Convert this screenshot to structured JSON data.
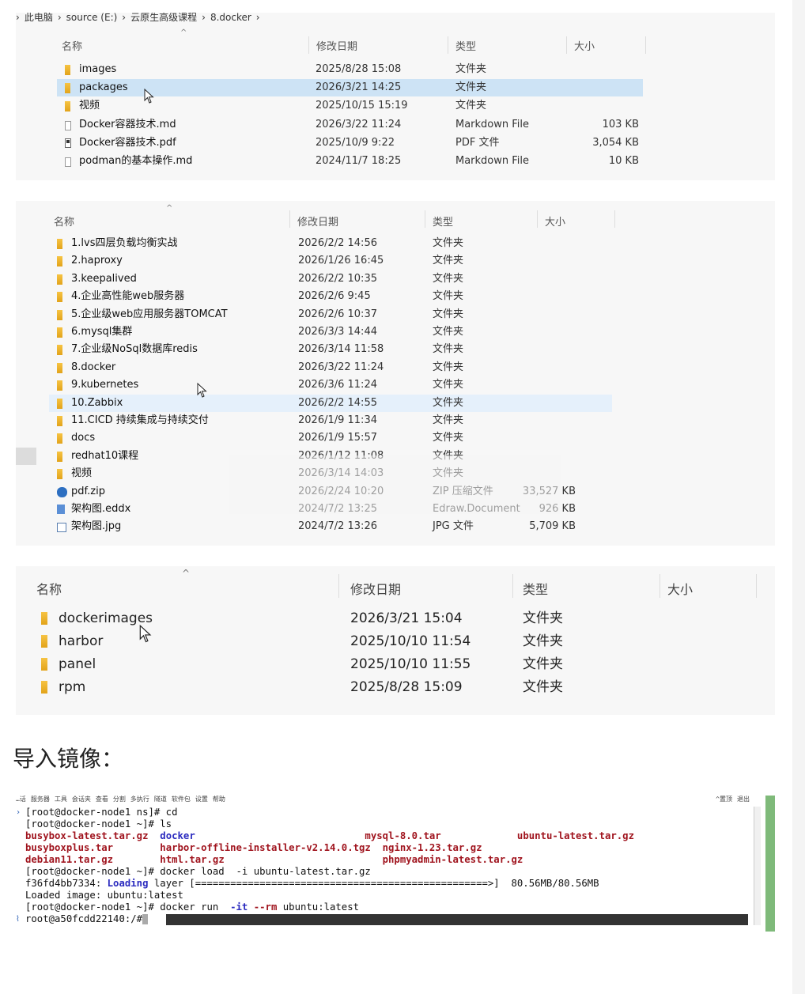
{
  "panel1": {
    "breadcrumb": [
      "›",
      "此电脑",
      "›",
      "source (E:)",
      "›",
      "云原生高级课程",
      "›",
      "8.docker",
      "›"
    ],
    "columns": {
      "name": "名称",
      "modified": "修改日期",
      "type": "类型",
      "size": "大小"
    },
    "rows": [
      {
        "icon": "folder-icon",
        "name": "images",
        "date": "2025/8/28 15:08",
        "type": "文件夹",
        "size": ""
      },
      {
        "icon": "folder-icon",
        "name": "packages",
        "date": "2026/3/21 14:25",
        "type": "文件夹",
        "size": ""
      },
      {
        "icon": "folder-icon",
        "name": "视频",
        "date": "2025/10/15 15:19",
        "type": "文件夹",
        "size": ""
      },
      {
        "icon": "markdown-file-icon",
        "name": "Docker容器技术.md",
        "date": "2026/3/22 11:24",
        "type": "Markdown File",
        "size": "103 KB"
      },
      {
        "icon": "pdf-file-icon",
        "name": "Docker容器技术.pdf",
        "date": "2025/10/9 9:22",
        "type": "PDF 文件",
        "size": "3,054 KB"
      },
      {
        "icon": "markdown-file-icon",
        "name": "podman的基本操作.md",
        "date": "2024/11/7 18:25",
        "type": "Markdown File",
        "size": "10 KB"
      }
    ]
  },
  "panel2": {
    "columns": {
      "name": "名称",
      "modified": "修改日期",
      "type": "类型",
      "size": "大小"
    },
    "rows": [
      {
        "icon": "folder-icon",
        "name": "1.lvs四层负载均衡实战",
        "date": "2026/2/2 14:56",
        "type": "文件夹",
        "size": ""
      },
      {
        "icon": "folder-icon",
        "name": "2.haproxy",
        "date": "2026/1/26 16:45",
        "type": "文件夹",
        "size": ""
      },
      {
        "icon": "folder-icon",
        "name": "3.keepalived",
        "date": "2026/2/2 10:35",
        "type": "文件夹",
        "size": ""
      },
      {
        "icon": "folder-icon",
        "name": "4.企业高性能web服务器",
        "date": "2026/2/6 9:45",
        "type": "文件夹",
        "size": ""
      },
      {
        "icon": "folder-icon",
        "name": "5.企业级web应用服务器TOMCAT",
        "date": "2026/2/6 10:37",
        "type": "文件夹",
        "size": ""
      },
      {
        "icon": "folder-icon",
        "name": "6.mysql集群",
        "date": "2026/3/3 14:44",
        "type": "文件夹",
        "size": ""
      },
      {
        "icon": "folder-icon",
        "name": "7.企业级NoSql数据库redis",
        "date": "2026/3/14 11:58",
        "type": "文件夹",
        "size": ""
      },
      {
        "icon": "folder-icon",
        "name": "8.docker",
        "date": "2026/3/22 11:24",
        "type": "文件夹",
        "size": ""
      },
      {
        "icon": "folder-icon",
        "name": "9.kubernetes",
        "date": "2026/3/6 11:24",
        "type": "文件夹",
        "size": ""
      },
      {
        "icon": "folder-icon",
        "name": "10.Zabbix",
        "date": "2026/2/2 14:55",
        "type": "文件夹",
        "size": ""
      },
      {
        "icon": "folder-icon",
        "name": "11.CICD  持续集成与持续交付",
        "date": "2026/1/9 11:34",
        "type": "文件夹",
        "size": ""
      },
      {
        "icon": "folder-icon",
        "name": "docs",
        "date": "2026/1/9 15:57",
        "type": "文件夹",
        "size": ""
      },
      {
        "icon": "folder-icon",
        "name": "redhat10课程",
        "date": "2026/1/12 11:08",
        "type": "文件夹",
        "size": ""
      },
      {
        "icon": "folder-icon",
        "name": "视频",
        "date": "2026/3/14 14:03",
        "type": "文件夹",
        "size": ""
      },
      {
        "icon": "zip-file-icon",
        "name": "pdf.zip",
        "date": "2026/2/24 10:20",
        "type": "ZIP 压缩文件",
        "size": "33,527 KB"
      },
      {
        "icon": "eddx-file-icon",
        "name": "架构图.eddx",
        "date": "2024/7/2 13:25",
        "type": "Edraw.Document",
        "size": "926 KB"
      },
      {
        "icon": "image-file-icon",
        "name": "架构图.jpg",
        "date": "2024/7/2 13:26",
        "type": "JPG 文件",
        "size": "5,709 KB"
      }
    ]
  },
  "panel3": {
    "columns": {
      "name": "名称",
      "modified": "修改日期",
      "type": "类型",
      "size": "大小"
    },
    "rows": [
      {
        "icon": "folder-icon",
        "name": "dockerimages",
        "date": "2026/3/21 15:04",
        "type": "文件夹"
      },
      {
        "icon": "folder-icon",
        "name": "harbor",
        "date": "2025/10/10 11:54",
        "type": "文件夹"
      },
      {
        "icon": "folder-icon",
        "name": "panel",
        "date": "2025/10/10 11:55",
        "type": "文件夹"
      },
      {
        "icon": "folder-icon",
        "name": "rpm",
        "date": "2025/8/28 15:09",
        "type": "文件夹"
      }
    ]
  },
  "heading": "导入镜像：",
  "terminal": {
    "menu": [
      "…话",
      "服务器",
      "工具",
      "会话夹",
      "查看",
      "分割",
      "多执行",
      "隧道",
      "软件包",
      "设置",
      "帮助"
    ],
    "menu_right": [
      "^置顶",
      "退出"
    ],
    "lines": [
      [
        {
          "t": "[root@docker-node1 ns]# cd"
        }
      ],
      [
        {
          "t": "[root@docker-node1 ~]# ls"
        }
      ],
      [
        {
          "t": "busybox-latest.tar.gz",
          "c": "tr"
        },
        {
          "t": "  "
        },
        {
          "t": "docker",
          "c": "tb"
        },
        {
          "t": "                             "
        },
        {
          "t": "mysql-8.0.tar",
          "c": "tr"
        },
        {
          "t": "             "
        },
        {
          "t": "ubuntu-latest.tar.gz",
          "c": "tr"
        }
      ],
      [
        {
          "t": "busyboxplus.tar",
          "c": "tr"
        },
        {
          "t": "        "
        },
        {
          "t": "harbor-offline-installer-v2.14.0.tgz",
          "c": "tr"
        },
        {
          "t": "  "
        },
        {
          "t": "nginx-1.23.tar.gz",
          "c": "tr"
        }
      ],
      [
        {
          "t": "debian11.tar.gz",
          "c": "tr"
        },
        {
          "t": "        "
        },
        {
          "t": "html.tar.gz",
          "c": "tr"
        },
        {
          "t": "                           "
        },
        {
          "t": "phpmyadmin-latest.tar.gz",
          "c": "tr"
        }
      ],
      [
        {
          "t": "[root@docker-node1 ~]# docker load  -i ubuntu-latest.tar.gz"
        }
      ],
      [
        {
          "t": "f36fd4bb7334: "
        },
        {
          "t": "Loading",
          "c": "tb"
        },
        {
          "t": " layer [==================================================>]  80.56MB/80.56MB"
        }
      ],
      [
        {
          "t": "Loaded image: ubuntu:latest"
        }
      ],
      [
        {
          "t": "[root@docker-node1 ~]# docker run  "
        },
        {
          "t": "-it",
          "c": "tb"
        },
        {
          "t": " "
        },
        {
          "t": "--rm",
          "c": "tr"
        },
        {
          "t": " ubuntu:latest"
        }
      ],
      [
        {
          "t": "root@a50fcdd22140:/#"
        }
      ]
    ]
  }
}
